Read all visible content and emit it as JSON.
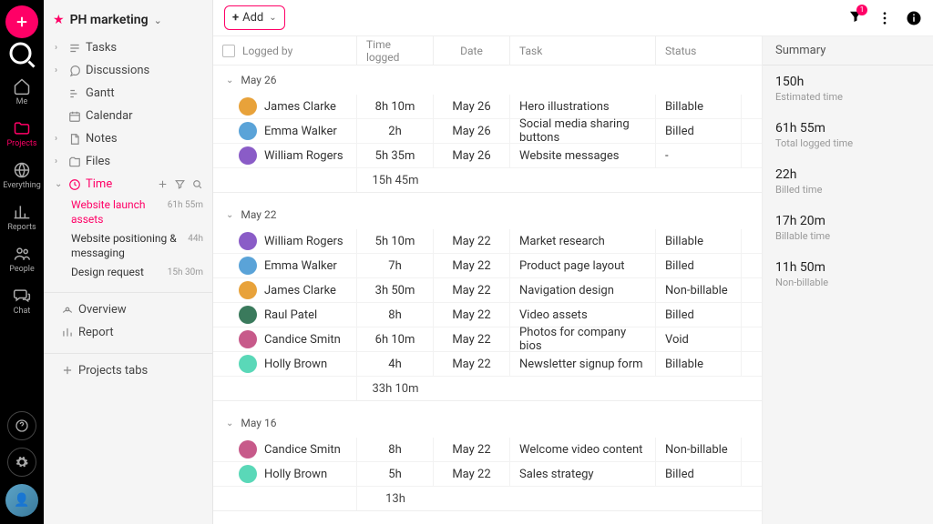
{
  "project": {
    "name": "PH marketing"
  },
  "rail": {
    "me": "Me",
    "projects": "Projects",
    "everything": "Everything",
    "reports": "Reports",
    "people": "People",
    "chat": "Chat"
  },
  "sidebar": {
    "tasks": "Tasks",
    "discussions": "Discussions",
    "gantt": "Gantt",
    "calendar": "Calendar",
    "notes": "Notes",
    "files": "Files",
    "time": "Time",
    "time_items": [
      {
        "label": "Website launch assets",
        "meta": "61h 55m"
      },
      {
        "label": "Website positioning & messaging",
        "meta": "44h"
      },
      {
        "label": "Design request",
        "meta": "15h 30m"
      }
    ],
    "overview": "Overview",
    "report": "Report",
    "projects_tabs": "Projects tabs"
  },
  "add_label": "Add",
  "columns": {
    "logged_by": "Logged by",
    "time_logged": "Time logged",
    "date": "Date",
    "task": "Task",
    "status": "Status"
  },
  "groups": [
    {
      "title": "May 26",
      "subtotal": "15h 45m",
      "rows": [
        {
          "name": "James Clarke",
          "time": "8h 10m",
          "date": "May 26",
          "task": "Hero illustrations",
          "status": "Billable",
          "color": "#e8a23a"
        },
        {
          "name": "Emma Walker",
          "time": "2h",
          "date": "May 26",
          "task": "Social media sharing buttons",
          "status": "Billed",
          "color": "#5aa3d8"
        },
        {
          "name": "William Rogers",
          "time": "5h 35m",
          "date": "May 26",
          "task": "Website messages",
          "status": "-",
          "color": "#8a5cc7"
        }
      ]
    },
    {
      "title": "May 22",
      "subtotal": "33h 10m",
      "rows": [
        {
          "name": "William Rogers",
          "time": "5h 10m",
          "date": "May 22",
          "task": "Market research",
          "status": "Billable",
          "color": "#8a5cc7"
        },
        {
          "name": "Emma Walker",
          "time": "7h",
          "date": "May 22",
          "task": "Product page layout",
          "status": "Billed",
          "color": "#5aa3d8"
        },
        {
          "name": "James Clarke",
          "time": "3h 50m",
          "date": "May 22",
          "task": "Navigation design",
          "status": "Non-billable",
          "color": "#e8a23a"
        },
        {
          "name": "Raul Patel",
          "time": "8h",
          "date": "May 22",
          "task": "Video assets",
          "status": "Billed",
          "color": "#3a7a5c"
        },
        {
          "name": "Candice Smitn",
          "time": "6h 10m",
          "date": "May 22",
          "task": "Photos for company bios",
          "status": "Void",
          "color": "#c75a8a"
        },
        {
          "name": "Holly Brown",
          "time": "4h",
          "date": "May 22",
          "task": "Newsletter signup form",
          "status": "Billable",
          "color": "#5ad8b8"
        }
      ]
    },
    {
      "title": "May 16",
      "subtotal": "13h",
      "rows": [
        {
          "name": "Candice Smitn",
          "time": "8h",
          "date": "May 22",
          "task": "Welcome video content",
          "status": "Non-billable",
          "color": "#c75a8a"
        },
        {
          "name": "Holly Brown",
          "time": "5h",
          "date": "May 22",
          "task": "Sales strategy",
          "status": "Billed",
          "color": "#5ad8b8"
        }
      ]
    }
  ],
  "summary": {
    "title": "Summary",
    "items": [
      {
        "val": "150h",
        "lab": "Estimated time"
      },
      {
        "val": "61h 55m",
        "lab": "Total logged time"
      },
      {
        "val": "22h",
        "lab": "Billed time"
      },
      {
        "val": "17h 20m",
        "lab": "Billable time"
      },
      {
        "val": "11h 50m",
        "lab": "Non-billable"
      }
    ]
  }
}
